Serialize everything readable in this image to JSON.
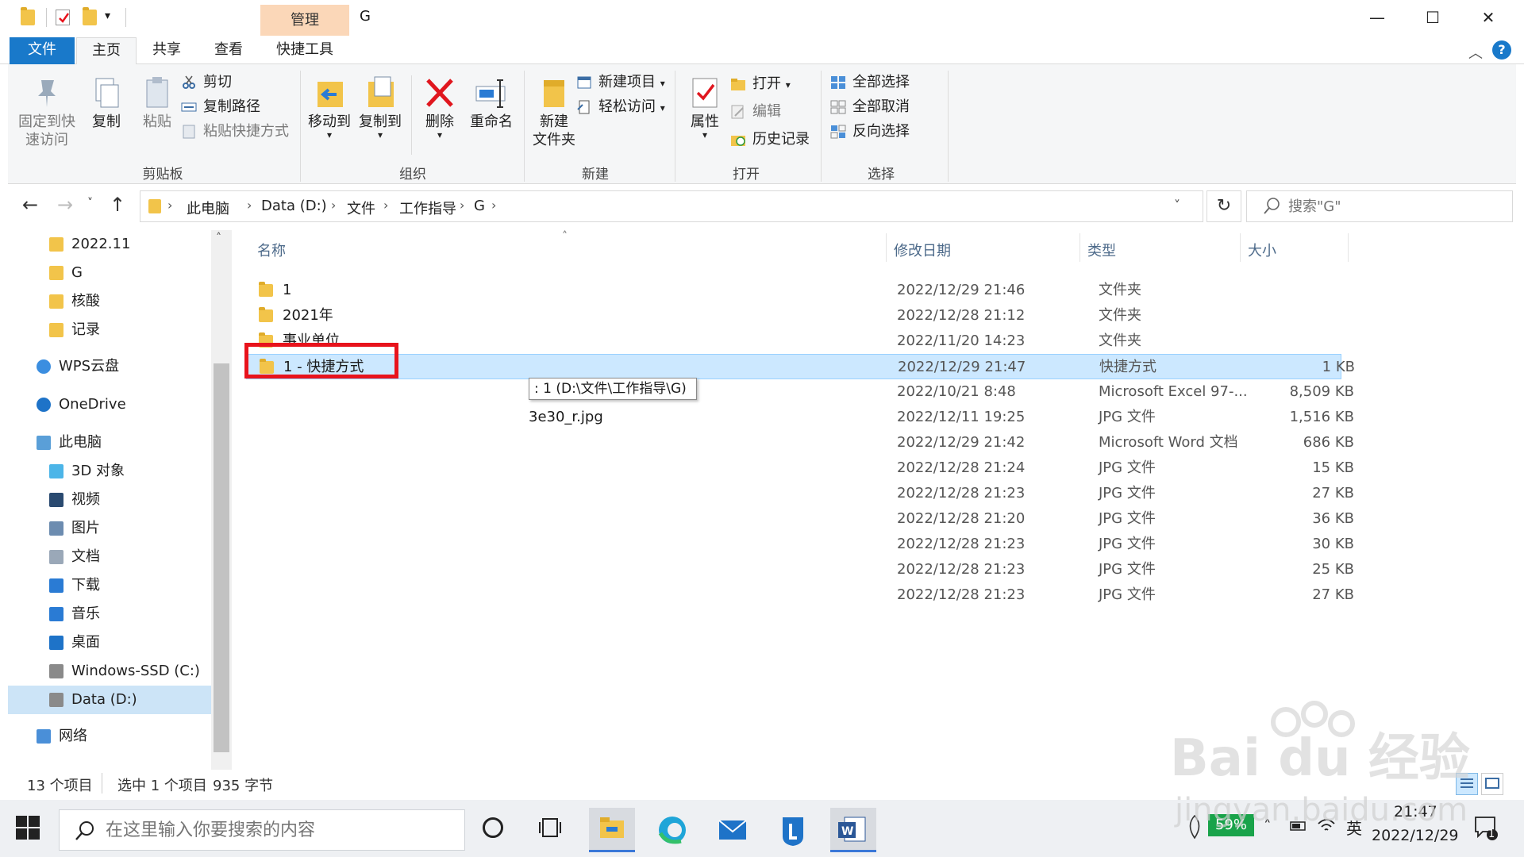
{
  "window": {
    "title": "G",
    "manage_tab": "管理",
    "minimize": "—",
    "maximize": "☐",
    "close": "✕"
  },
  "tabs": {
    "file": "文件",
    "home": "主页",
    "share": "共享",
    "view": "查看",
    "shortcut_tools": "快捷工具"
  },
  "ribbon": {
    "clipboard": {
      "label": "剪贴板",
      "pin": "固定到快\n速访问",
      "pin_line1": "固定到快",
      "pin_line2": "速访问",
      "copy": "复制",
      "paste": "粘贴",
      "cut": "剪切",
      "copy_path": "复制路径",
      "paste_shortcut": "粘贴快捷方式"
    },
    "organize": {
      "label": "组织",
      "move_to": "移动到",
      "copy_to": "复制到",
      "delete": "删除",
      "rename": "重命名"
    },
    "new": {
      "label": "新建",
      "new_folder_line1": "新建",
      "new_folder_line2": "文件夹",
      "new_item": "新建项目",
      "easy_access": "轻松访问"
    },
    "open": {
      "label": "打开",
      "properties": "属性",
      "open": "打开",
      "edit": "编辑",
      "history": "历史记录"
    },
    "select": {
      "label": "选择",
      "select_all": "全部选择",
      "select_none": "全部取消",
      "invert": "反向选择"
    }
  },
  "address": {
    "crumbs": [
      "此电脑",
      "Data (D:)",
      "文件",
      "工作指导",
      "G"
    ],
    "search_placeholder": "搜索\"G\""
  },
  "nav_pane": {
    "items": [
      {
        "label": "2022.11",
        "icon": "folder-icon"
      },
      {
        "label": "G",
        "icon": "folder-icon"
      },
      {
        "label": "核酸",
        "icon": "folder-icon"
      },
      {
        "label": "记录",
        "icon": "folder-icon"
      },
      {
        "label": "WPS云盘",
        "icon": "cloud-icon"
      },
      {
        "label": "OneDrive",
        "icon": "onedrive-icon"
      },
      {
        "label": "此电脑",
        "icon": "computer-icon"
      },
      {
        "label": "3D 对象",
        "icon": "cube-icon"
      },
      {
        "label": "视频",
        "icon": "video-icon"
      },
      {
        "label": "图片",
        "icon": "picture-icon"
      },
      {
        "label": "文档",
        "icon": "document-icon"
      },
      {
        "label": "下载",
        "icon": "download-icon"
      },
      {
        "label": "音乐",
        "icon": "music-icon"
      },
      {
        "label": "桌面",
        "icon": "desktop-icon"
      },
      {
        "label": "Windows-SSD (C:)",
        "icon": "drive-icon"
      },
      {
        "label": "Data (D:)",
        "icon": "drive-icon"
      },
      {
        "label": "网络",
        "icon": "network-icon"
      }
    ]
  },
  "columns": {
    "name": "名称",
    "date": "修改日期",
    "type": "类型",
    "size": "大小"
  },
  "files": [
    {
      "name": "1",
      "date": "2022/12/29 21:46",
      "type": "文件夹",
      "size": ""
    },
    {
      "name": "2021年",
      "date": "2022/12/28 21:12",
      "type": "文件夹",
      "size": ""
    },
    {
      "name": "事业单位",
      "date": "2022/11/20 14:23",
      "type": "文件夹",
      "size": ""
    },
    {
      "name": "1 - 快捷方式",
      "date": "2022/12/29 21:47",
      "type": "快捷方式",
      "size": "1 KB"
    },
    {
      "name": "",
      "date": "2022/10/21 8:48",
      "type": "Microsoft Excel 97-...",
      "size": "8,509 KB"
    },
    {
      "name": "3e30_r.jpg",
      "date": "2022/12/11 19:25",
      "type": "JPG 文件",
      "size": "1,516 KB"
    },
    {
      "name": "",
      "date": "2022/12/29 21:42",
      "type": "Microsoft Word 文档",
      "size": "686 KB"
    },
    {
      "name": "",
      "date": "2022/12/28 21:24",
      "type": "JPG 文件",
      "size": "15 KB"
    },
    {
      "name": "",
      "date": "2022/12/28 21:23",
      "type": "JPG 文件",
      "size": "27 KB"
    },
    {
      "name": "",
      "date": "2022/12/28 21:20",
      "type": "JPG 文件",
      "size": "36 KB"
    },
    {
      "name": "",
      "date": "2022/12/28 21:23",
      "type": "JPG 文件",
      "size": "30 KB"
    },
    {
      "name": "",
      "date": "2022/12/28 21:23",
      "type": "JPG 文件",
      "size": "25 KB"
    },
    {
      "name": "",
      "date": "2022/12/28 21:23",
      "type": "JPG 文件",
      "size": "27 KB"
    }
  ],
  "tooltip": ": 1 (D:\\文件\\工作指导\\G)",
  "status": {
    "count": "13 个项目",
    "selected": "选中 1 个项目",
    "bytes": "935 字节"
  },
  "taskbar": {
    "search_placeholder": "在这里输入你要搜索的内容",
    "battery": "59%",
    "ime": "英",
    "time": "21:47",
    "date": "2022/12/29",
    "notifications": "1"
  },
  "watermark": {
    "brand": "Bai du 经验",
    "url": "jingyan.baidu.com"
  },
  "colors": {
    "accent": "#1979ca",
    "selection": "#cce8ff",
    "highlight_box": "#e8131c",
    "manage_tab": "#fbd7b8"
  }
}
